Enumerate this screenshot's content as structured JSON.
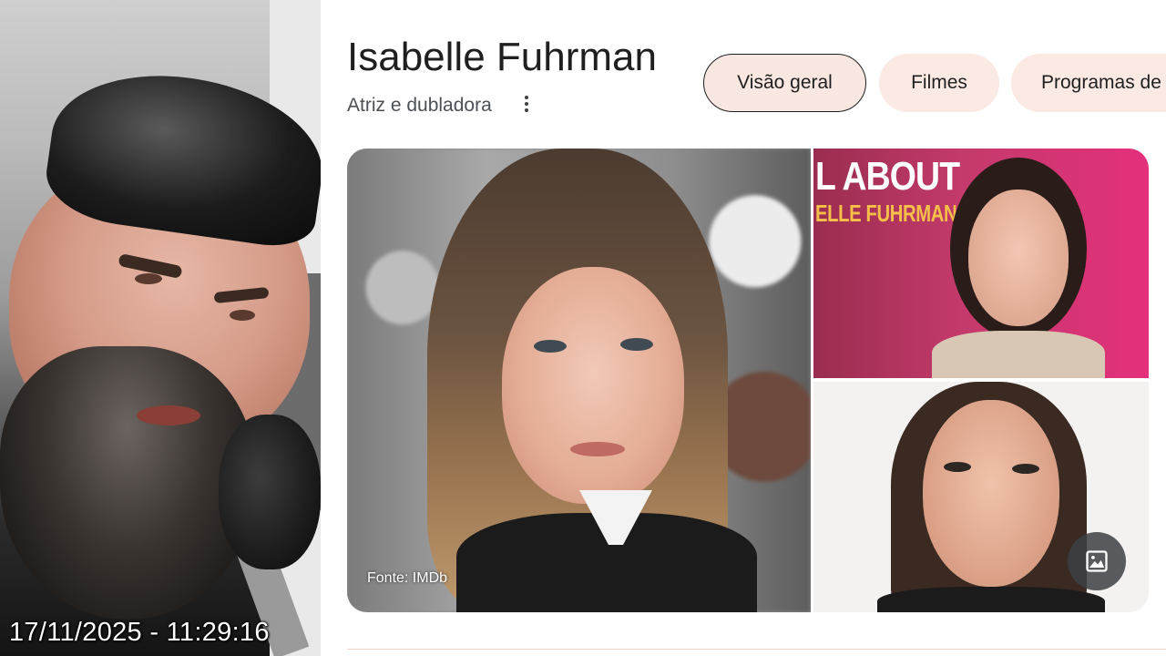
{
  "overlay": {
    "timestamp": "17/11/2025 - 11:29:16"
  },
  "knowledge_panel": {
    "title": "Isabelle Fuhrman",
    "subtitle": "Atriz e dubladora",
    "more_icon": "more-vert-icon",
    "tabs": [
      {
        "label": "Visão geral",
        "active": true
      },
      {
        "label": "Filmes",
        "active": false
      },
      {
        "label": "Programas de",
        "active": false
      }
    ],
    "images": {
      "main_caption": "Fonte: IMDb",
      "top_right_banner_line1": "L ABOUT",
      "top_right_banner_line2": "ELLE FUHRMAN",
      "gallery_icon": "image-gallery-icon"
    },
    "colors": {
      "chip_bg": "#fbe9e4",
      "chip_active_border": "#1f1f1f",
      "title_text": "#1f1f1f",
      "subtitle_text": "#4d5156"
    }
  }
}
